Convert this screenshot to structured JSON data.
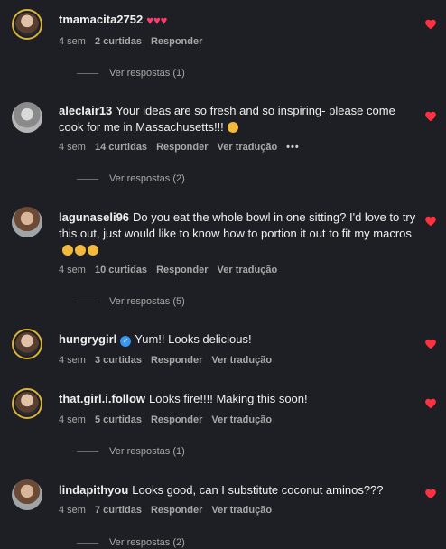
{
  "comments": [
    {
      "username": "tmamacita2752",
      "verified": false,
      "text": "",
      "trailing_emoji": [
        "heart",
        "heart",
        "heart"
      ],
      "time": "4 sem",
      "likes": "2 curtidas",
      "reply": "Responder",
      "translate": "",
      "more": "",
      "view_replies": "Ver respostas (1)",
      "liked": true
    },
    {
      "username": "aleclair13",
      "verified": false,
      "text": "Your ideas are so fresh and so inspiring- please come cook for me in Massachusetts!!!",
      "trailing_emoji": [
        "grin"
      ],
      "time": "4 sem",
      "likes": "14 curtidas",
      "reply": "Responder",
      "translate": "Ver tradução",
      "more": "•••",
      "view_replies": "Ver respostas (2)",
      "liked": true
    },
    {
      "username": "lagunaseli96",
      "verified": false,
      "text": "Do you eat the whole bowl in one sitting? I'd love to try this out, just would like to know how to portion it out to fit my macros",
      "trailing_emoji": [
        "smile",
        "smile",
        "smile"
      ],
      "time": "4 sem",
      "likes": "10 curtidas",
      "reply": "Responder",
      "translate": "Ver tradução",
      "more": "",
      "view_replies": "Ver respostas (5)",
      "liked": true
    },
    {
      "username": "hungrygirl",
      "verified": true,
      "text": "Yum!! Looks delicious!",
      "trailing_emoji": [],
      "time": "4 sem",
      "likes": "3 curtidas",
      "reply": "Responder",
      "translate": "Ver tradução",
      "more": "",
      "view_replies": "",
      "liked": true
    },
    {
      "username": "that.girl.i.follow",
      "verified": false,
      "text": "Looks fire!!!! Making this soon!",
      "trailing_emoji": [],
      "time": "4 sem",
      "likes": "5 curtidas",
      "reply": "Responder",
      "translate": "Ver tradução",
      "more": "",
      "view_replies": "Ver respostas (1)",
      "liked": true
    },
    {
      "username": "lindapithyou",
      "verified": false,
      "text": "Looks good, can I substitute coconut aminos???",
      "trailing_emoji": [],
      "time": "4 sem",
      "likes": "7 curtidas",
      "reply": "Responder",
      "translate": "Ver tradução",
      "more": "",
      "view_replies": "Ver respostas (2)",
      "liked": true
    }
  ],
  "colors": {
    "background": "#1e1f24",
    "heart": "#ff3040",
    "muted_text": "#a8a8a8",
    "story_ring": "#d9b23a",
    "verified": "#3897f0"
  },
  "icons": [
    "heart-icon",
    "verified-badge-icon",
    "more-options-icon"
  ]
}
